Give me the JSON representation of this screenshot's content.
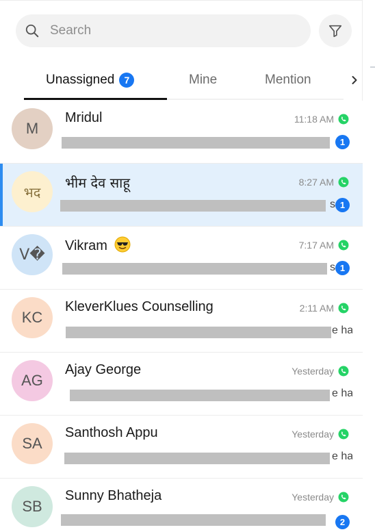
{
  "search": {
    "placeholder": "Search"
  },
  "icons": {
    "search": "search-icon",
    "filter": "filter-icon",
    "next": "chevron-right-icon",
    "channel": "whatsapp-icon"
  },
  "colors": {
    "accent": "#1877f2",
    "whatsapp": "#25d366",
    "selected_row": "#e3f0fc",
    "selected_bar": "#2d8cf0"
  },
  "tabs": [
    {
      "label": "Unassigned",
      "badge": "7",
      "active": true
    },
    {
      "label": "Mine",
      "active": false
    },
    {
      "label": "Mention",
      "active": false
    }
  ],
  "conversations": [
    {
      "initials": "M",
      "name": "Mridul",
      "time": "11:18 AM",
      "unread": "1",
      "avatar_color": "#e3d0c3",
      "preview_tail": ""
    },
    {
      "initials": "भद",
      "name": "भीम देव साहू",
      "time": "8:27 AM",
      "unread": "1",
      "avatar_color": "#fdf0cf",
      "preview_tail": "s",
      "selected": true
    },
    {
      "initials": "V�",
      "name": "Vikram",
      "name_emoji": "smiling-face-with-sunglasses",
      "time": "7:17 AM",
      "unread": "1",
      "avatar_color": "#cfe4f7",
      "preview_tail": "s"
    },
    {
      "initials": "KC",
      "name": "KleverKlues Counselling",
      "time": "2:11 AM",
      "unread": "",
      "avatar_color": "#fbdcc7",
      "preview_tail": "e ha"
    },
    {
      "initials": "AG",
      "name": "Ajay George",
      "time": "Yesterday",
      "unread": "",
      "avatar_color": "#f4c9e2",
      "preview_tail": "e ha"
    },
    {
      "initials": "SA",
      "name": "Santhosh Appu",
      "time": "Yesterday",
      "unread": "",
      "avatar_color": "#fbdcc7",
      "preview_tail": "e ha"
    },
    {
      "initials": "SB",
      "name": "Sunny Bhatheja",
      "time": "Yesterday",
      "unread": "2",
      "avatar_color": "#cfe9df",
      "preview_tail": ""
    }
  ]
}
